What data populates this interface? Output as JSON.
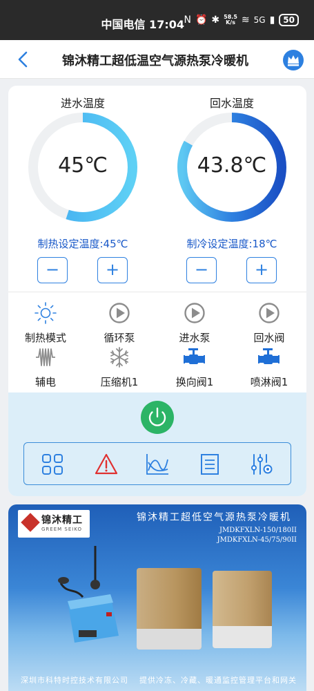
{
  "status_bar": {
    "carrier_time": "中国电信 17:04",
    "net_speed_top": "58.5",
    "net_speed_bottom": "K/s",
    "network_type": "5G",
    "battery": "50"
  },
  "navbar": {
    "title": "锦沐精工超低温空气源热泵冷暖机"
  },
  "gauges": [
    {
      "title": "进水温度",
      "value": "45℃",
      "setpoint": "制热设定温度:45℃",
      "fill": 0.55,
      "style": "light"
    },
    {
      "title": "回水温度",
      "value": "43.8℃",
      "setpoint": "制冷设定温度:18℃",
      "fill": 0.83,
      "style": "deep"
    }
  ],
  "stepper": {
    "minus": "−",
    "plus": "+"
  },
  "status_items": [
    {
      "label": "制热模式",
      "icon": "sun-icon",
      "active": true
    },
    {
      "label": "循环泵",
      "icon": "play-circle-icon",
      "active": false
    },
    {
      "label": "进水泵",
      "icon": "play-circle-icon",
      "active": false
    },
    {
      "label": "回水阀",
      "icon": "play-circle-icon",
      "active": false
    },
    {
      "label": "辅电",
      "icon": "heater-coil-icon",
      "active": false
    },
    {
      "label": "压缩机1",
      "icon": "snowflake-icon",
      "active": false
    },
    {
      "label": "换向阀1",
      "icon": "valve-icon",
      "active": true
    },
    {
      "label": "喷淋阀1",
      "icon": "valve-icon",
      "active": true
    }
  ],
  "toolbar": [
    "grid-icon",
    "warning-icon",
    "chart-icon",
    "list-icon",
    "sliders-icon"
  ],
  "colors": {
    "accent": "#2d80e0",
    "power": "#2cb466",
    "alarm": "#e03030",
    "panel": "#dceef9"
  },
  "banner": {
    "logo_text": "锦沐精工",
    "logo_sub": "GREEM SEIKO",
    "headline": "锦沐精工超低空气源热泵冷暖机",
    "model_1": "JMDKFXLN-150/180II",
    "model_2": "JMDKFXLN-45/75/90II",
    "footer_left": "深圳市科特时控技术有限公司",
    "footer_right": "提供冷冻、冷藏、暖通监控管理平台和网关"
  }
}
